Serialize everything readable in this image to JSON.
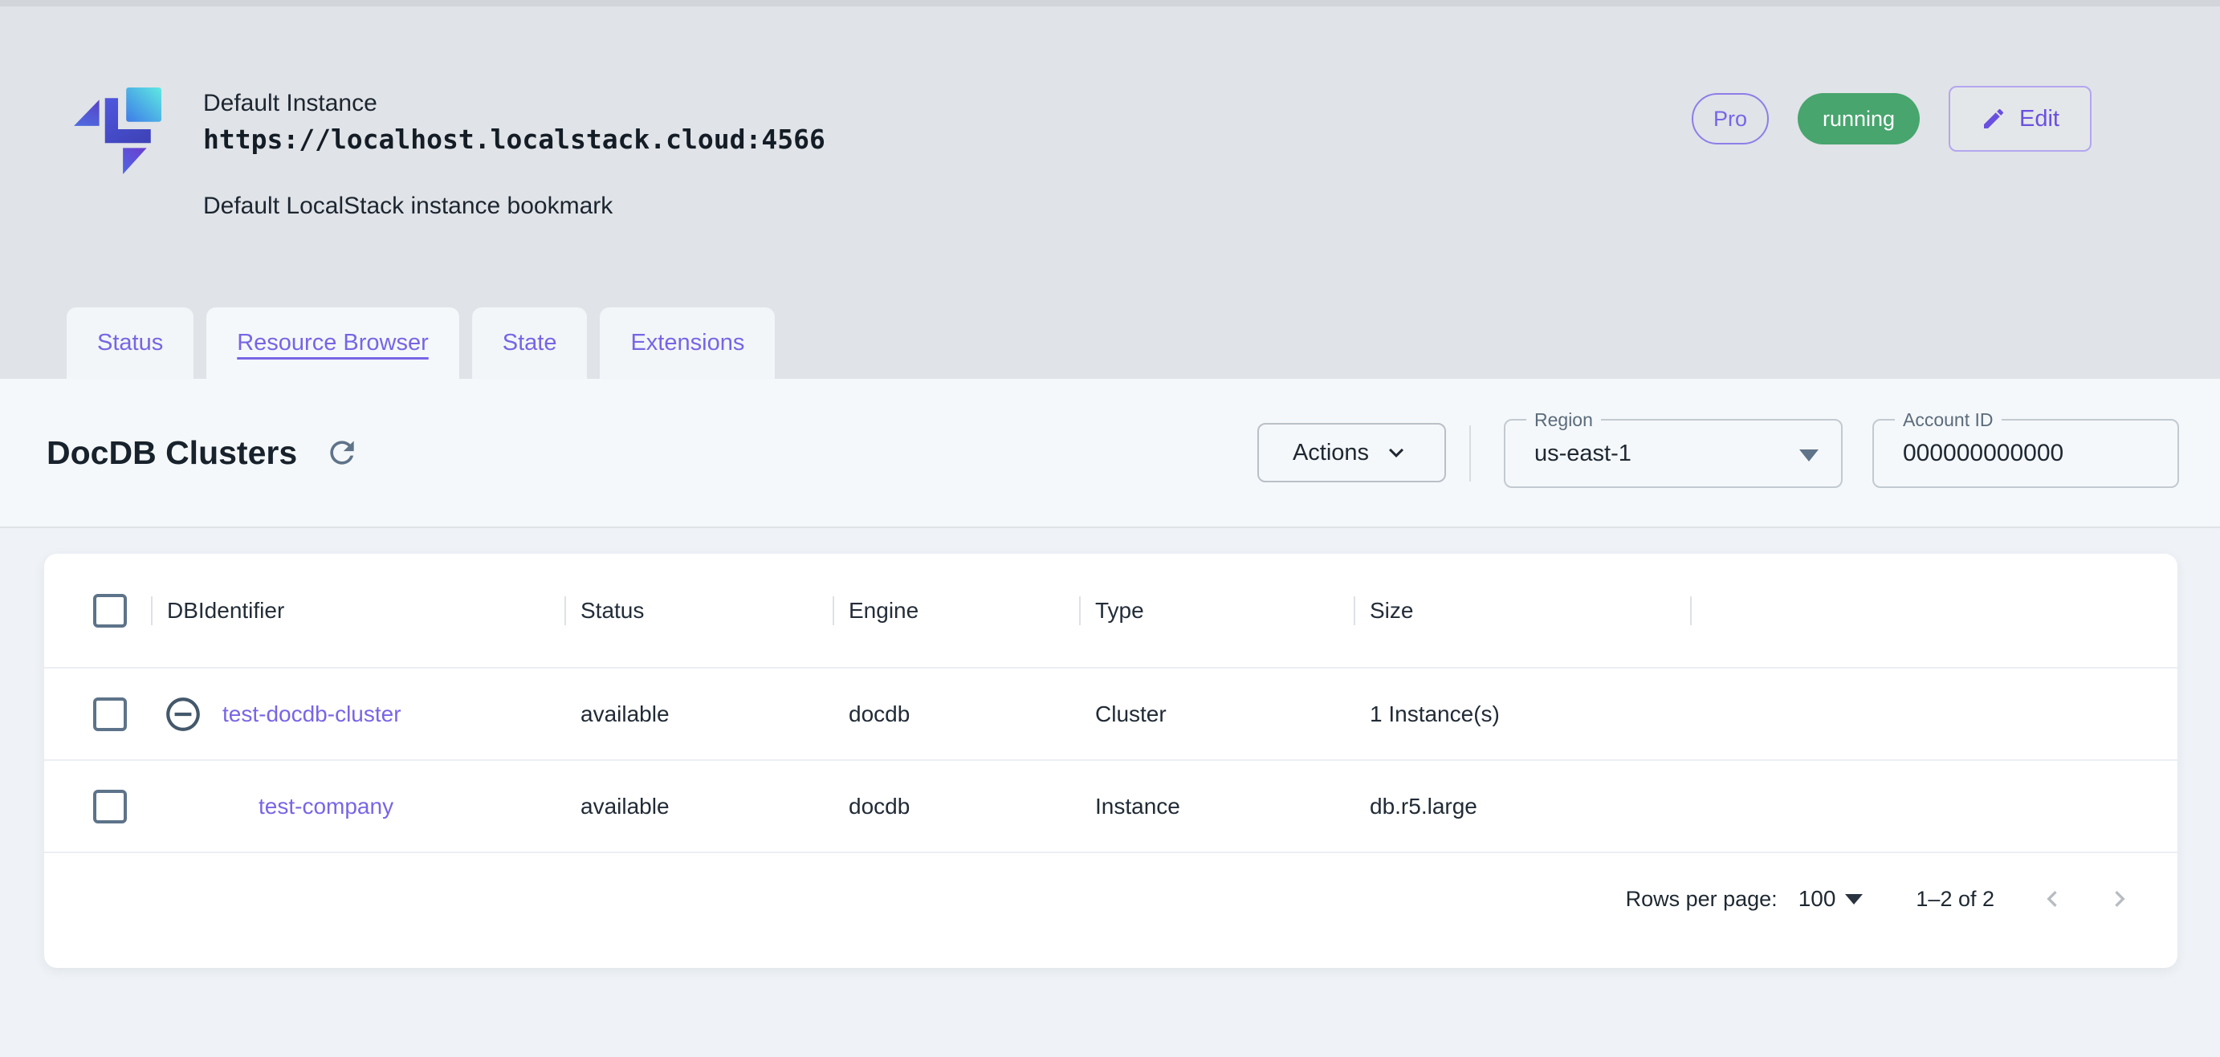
{
  "header": {
    "title": "Default Instance",
    "url": "https://localhost.localstack.cloud:4566",
    "subtitle": "Default LocalStack instance bookmark",
    "pro_badge": "Pro",
    "status_badge": "running",
    "edit_button": "Edit"
  },
  "tabs": [
    {
      "label": "Status",
      "active": false
    },
    {
      "label": "Resource Browser",
      "active": true
    },
    {
      "label": "State",
      "active": false
    },
    {
      "label": "Extensions",
      "active": false
    }
  ],
  "toolbar": {
    "title": "DocDB Clusters",
    "actions_button": "Actions",
    "region": {
      "label": "Region",
      "value": "us-east-1"
    },
    "account_id": {
      "label": "Account ID",
      "value": "000000000000"
    }
  },
  "table": {
    "columns": [
      "DBIdentifier",
      "Status",
      "Engine",
      "Type",
      "Size"
    ],
    "rows": [
      {
        "db_identifier": "test-docdb-cluster",
        "status": "available",
        "engine": "docdb",
        "type": "Cluster",
        "size": "1 Instance(s)",
        "expandable": true
      },
      {
        "db_identifier": "test-company",
        "status": "available",
        "engine": "docdb",
        "type": "Instance",
        "size": "db.r5.large",
        "expandable": false
      }
    ]
  },
  "pagination": {
    "rows_per_page_label": "Rows per page:",
    "rows_per_page_value": "100",
    "range_label": "1–2 of 2"
  },
  "icons": {
    "logo": "localstack-logo",
    "edit": "pencil-icon",
    "refresh": "refresh-icon",
    "actions_chevron": "chevron-down-icon",
    "expander": "minus-circle-icon",
    "prev": "chevron-left-icon",
    "next": "chevron-right-icon"
  },
  "colors": {
    "accent_purple": "#7765e5",
    "success_green": "#47a56d",
    "header_bg": "#e0e3e7",
    "toolbar_bg": "#f5f8fa",
    "content_bg": "#eff3f7"
  }
}
